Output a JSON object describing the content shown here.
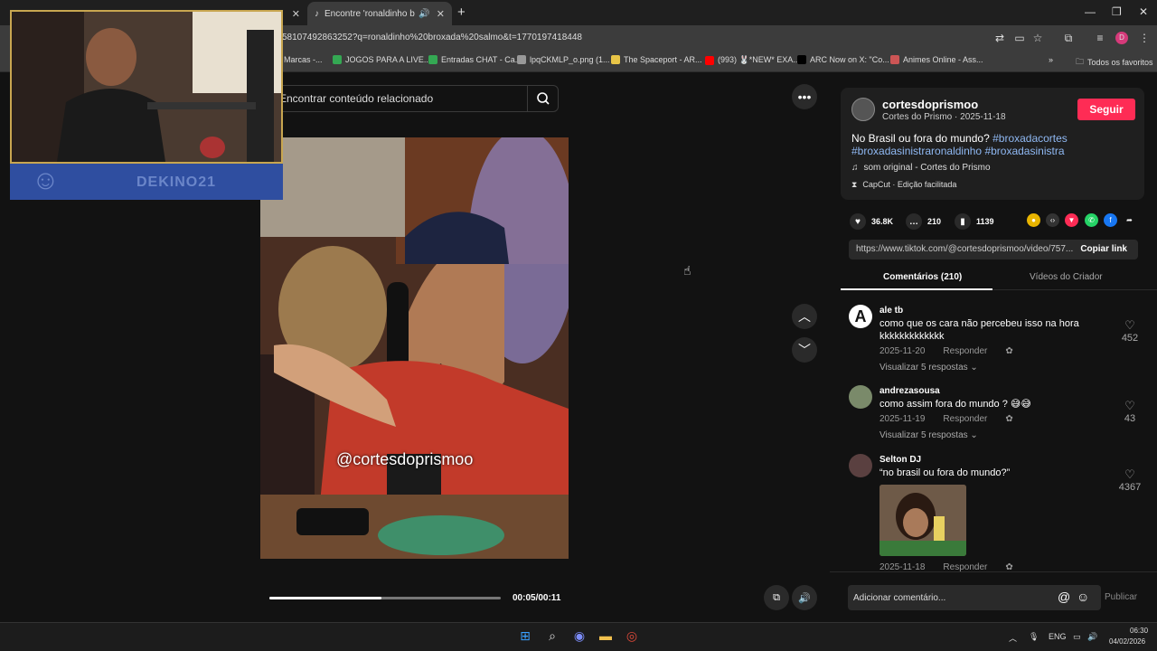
{
  "browser": {
    "active_tab_title": "Encontre 'ronaldinho broxada",
    "url": "58107492863252?q=ronaldinho%20broxada%20salmo&t=1770197418448",
    "bookmarks": [
      {
        "label": "Marcas -...",
        "color": "#888888"
      },
      {
        "label": "JOGOS PARA A LIVE...",
        "color": "#34a853"
      },
      {
        "label": "Entradas CHAT - Ca...",
        "color": "#34a853"
      },
      {
        "label": "lpqCKMLP_o.png (1...",
        "color": "#999999"
      },
      {
        "label": "The Spaceport - AR...",
        "color": "#e8c547"
      },
      {
        "label": "(993) 🐰*NEW* EXA...",
        "color": "#ff0000"
      },
      {
        "label": "ARC Now on X: \"Co...",
        "color": "#000000"
      },
      {
        "label": "Animes Online - Ass...",
        "color": "#c55"
      }
    ],
    "all_bookmarks": "Todos os favoritos",
    "profile_initial": "D"
  },
  "search": {
    "placeholder": "Encontrar conteúdo relacionado"
  },
  "video": {
    "watermark": "@cortesdoprismoo",
    "time": "00:05/00:11",
    "progress": 0.486
  },
  "webcam": {
    "handle": "DEKINO21"
  },
  "post": {
    "username": "cortesdoprismoo",
    "subtitle": "Cortes do Prismo · 2025-11-18",
    "follow": "Seguir",
    "desc_text": "No Brasil ou fora do mundo? ",
    "tags": [
      "#broxadacortes",
      "#broxadasinistraronaldinho",
      "#broxadasinistra"
    ],
    "sound": "som original - Cortes do Prismo",
    "capcut": "CapCut · Edição facilitada",
    "likes": "36.8K",
    "comments": "210",
    "saves": "1139",
    "link": "https://www.tiktok.com/@cortesdoprismoo/video/757...",
    "copy_link": "Copiar link"
  },
  "tabs": {
    "comments": "Comentários (210)",
    "videos": "Vídeos do Criador"
  },
  "comments": [
    {
      "user": "ale tb",
      "text": "como que os cara não percebeu isso na hora kkkkkkkkkkkkk",
      "date": "2025-11-20",
      "reply": "Responder",
      "replies": "Visualizar 5 respostas",
      "likes": "452"
    },
    {
      "user": "andrezasousa",
      "text": "como assim fora do mundo ? 😅😅",
      "date": "2025-11-19",
      "reply": "Responder",
      "replies": "Visualizar 5 respostas",
      "likes": "43"
    },
    {
      "user": "Selton DJ",
      "text": "“no brasil ou fora do mundo?”",
      "date": "2025-11-18",
      "reply": "Responder",
      "likes": "4367"
    }
  ],
  "comment_box": {
    "placeholder": "Adicionar comentário...",
    "publish": "Publicar"
  },
  "taskbar": {
    "lang": "ENG",
    "time": "06:30",
    "date": "04/02/2026"
  }
}
